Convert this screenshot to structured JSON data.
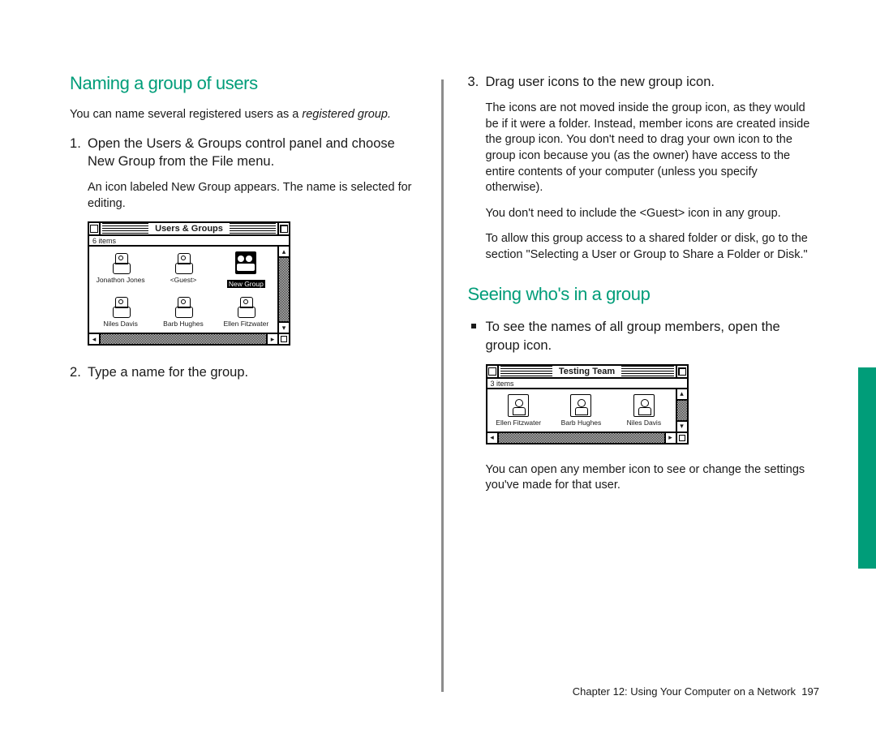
{
  "left": {
    "heading": "Naming a group of users",
    "intro_a": "You can name several registered users as a ",
    "intro_em": "registered group.",
    "step1": "Open the Users & Groups control panel and choose New Group from the File menu.",
    "step1_sub": "An icon labeled New Group appears. The name is selected for editing.",
    "step2": "Type a name for the group."
  },
  "fig1": {
    "title": "Users & Groups",
    "info": "6 items",
    "icons": [
      {
        "label": "Jonathon Jones",
        "type": "user"
      },
      {
        "label": "<Guest>",
        "type": "user"
      },
      {
        "label": "New Group",
        "type": "group",
        "selected": true
      },
      {
        "label": "Niles Davis",
        "type": "user"
      },
      {
        "label": "Barb Hughes",
        "type": "user"
      },
      {
        "label": "Ellen Fitzwater",
        "type": "user"
      }
    ]
  },
  "right": {
    "step3": "Drag user icons to the new group icon.",
    "step3_sub1": "The icons are not moved inside the group icon, as they would be if it were a folder. Instead, member icons are created inside the group icon. You don't need to drag your own icon to the group icon because you (as the owner) have access to the entire contents of your computer (unless you specify otherwise).",
    "step3_sub2": "You don't need to include the <Guest> icon in any group.",
    "step3_sub3": "To allow this group access to a shared folder or disk, go to the section \"Selecting a User or Group to Share a Folder or Disk.\"",
    "heading2": "Seeing who's in a group",
    "bullet1": "To see the names of all group members, open the group icon.",
    "after_fig": "You can open any member icon to see or change the settings you've made for that user."
  },
  "fig2": {
    "title": "Testing Team",
    "info": "3 items",
    "icons": [
      {
        "label": "Ellen Fitzwater",
        "type": "member"
      },
      {
        "label": "Barb Hughes",
        "type": "member"
      },
      {
        "label": "Niles Davis",
        "type": "member"
      }
    ]
  },
  "footer": {
    "chapter": "Chapter 12: Using Your Computer on a Network",
    "page": "197"
  }
}
